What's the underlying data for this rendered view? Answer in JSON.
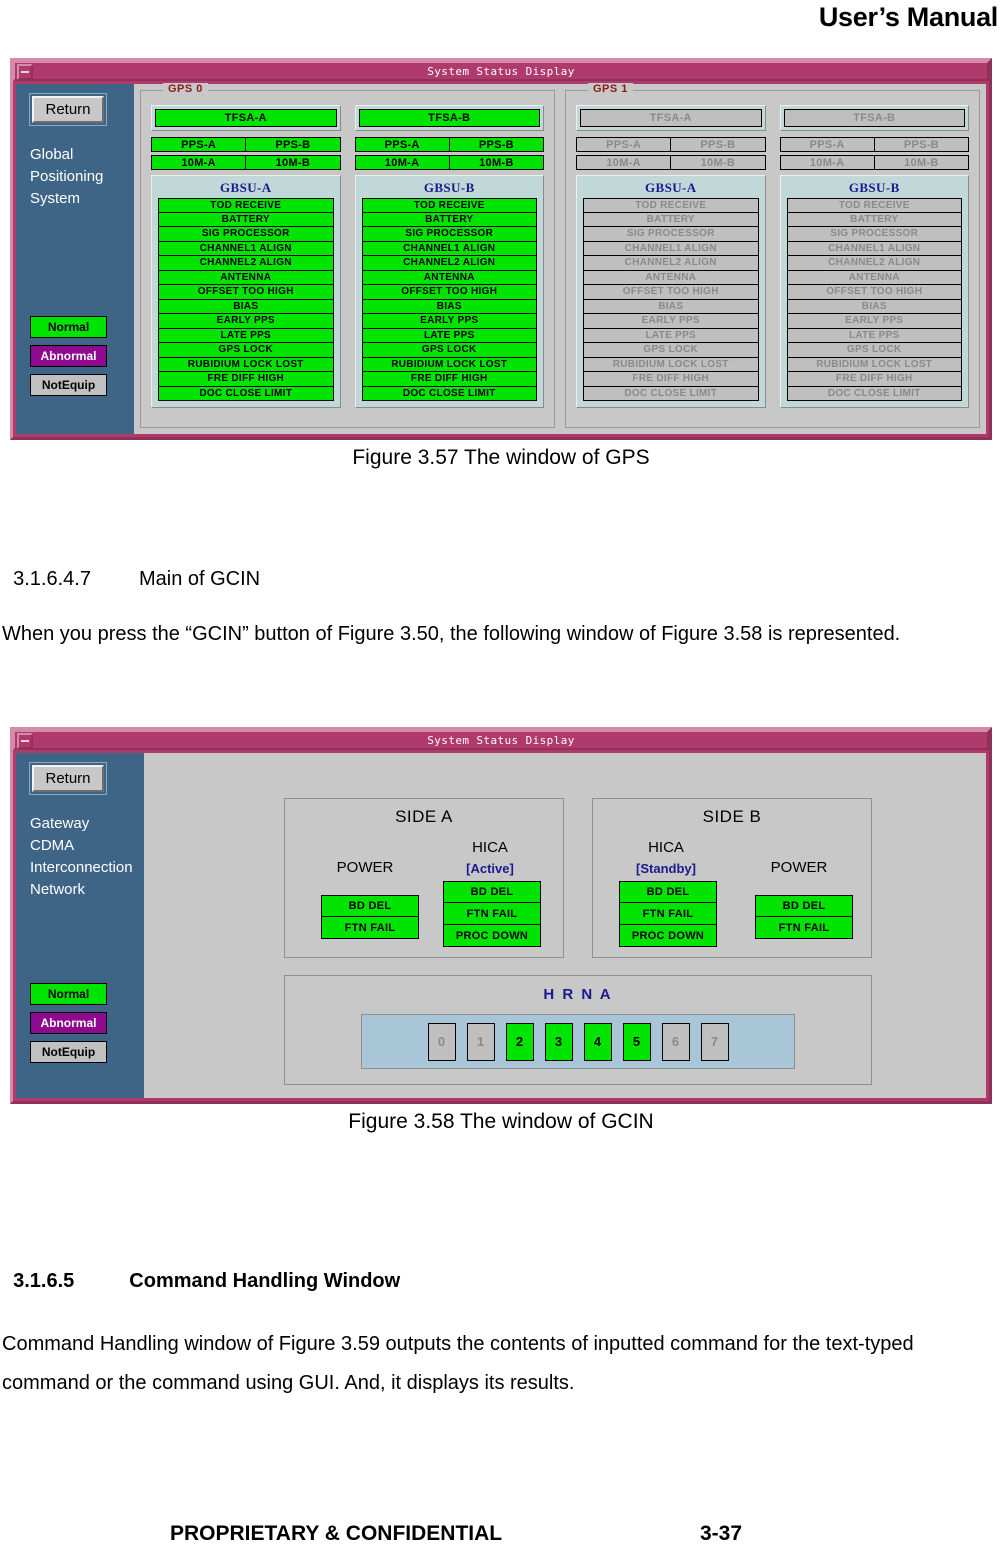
{
  "document": {
    "header_title": "User’s Manual",
    "footer_proprietary": "PROPRIETARY & CONFIDENTIAL",
    "footer_page": "3-37"
  },
  "figure_gps": {
    "caption": "Figure 3.57 The window of GPS",
    "window_title": "System Status Display",
    "sidebar": {
      "return_label": "Return",
      "system_name": "Global\nPositioning\nSystem",
      "legend": [
        {
          "label": "Normal",
          "state": "normal",
          "color": "#00e400"
        },
        {
          "label": "Abnormal",
          "state": "abnormal",
          "color": "#8e0a8e"
        },
        {
          "label": "NotEquip",
          "state": "notequip",
          "color": "#c0c0c0"
        }
      ]
    },
    "groups": [
      {
        "label": "GPS 0",
        "state": "on",
        "columns": [
          {
            "tfsa": "TFSA-A",
            "pps": [
              "PPS-A",
              "PPS-B"
            ],
            "tenm": [
              "10M-A",
              "10M-B"
            ],
            "gbsu_title": "GBSU-A",
            "gbsu_items": [
              "TOD RECEIVE",
              "BATTERY",
              "SIG PROCESSOR",
              "CHANNEL1 ALIGN",
              "CHANNEL2 ALIGN",
              "ANTENNA",
              "OFFSET TOO HIGH",
              "BIAS",
              "EARLY PPS",
              "LATE PPS",
              "GPS LOCK",
              "RUBIDIUM LOCK LOST",
              "FRE DIFF HIGH",
              "DOC CLOSE LIMIT"
            ]
          },
          {
            "tfsa": "TFSA-B",
            "pps": [
              "PPS-A",
              "PPS-B"
            ],
            "tenm": [
              "10M-A",
              "10M-B"
            ],
            "gbsu_title": "GBSU-B",
            "gbsu_items": [
              "TOD RECEIVE",
              "BATTERY",
              "SIG PROCESSOR",
              "CHANNEL1 ALIGN",
              "CHANNEL2 ALIGN",
              "ANTENNA",
              "OFFSET TOO HIGH",
              "BIAS",
              "EARLY PPS",
              "LATE PPS",
              "GPS LOCK",
              "RUBIDIUM LOCK LOST",
              "FRE DIFF HIGH",
              "DOC CLOSE LIMIT"
            ]
          }
        ]
      },
      {
        "label": "GPS 1",
        "state": "off",
        "columns": [
          {
            "tfsa": "TFSA-A",
            "pps": [
              "PPS-A",
              "PPS-B"
            ],
            "tenm": [
              "10M-A",
              "10M-B"
            ],
            "gbsu_title": "GBSU-A",
            "gbsu_items": [
              "TOD RECEIVE",
              "BATTERY",
              "SIG PROCESSOR",
              "CHANNEL1 ALIGN",
              "CHANNEL2 ALIGN",
              "ANTENNA",
              "OFFSET TOO HIGH",
              "BIAS",
              "EARLY PPS",
              "LATE PPS",
              "GPS LOCK",
              "RUBIDIUM LOCK LOST",
              "FRE DIFF HIGH",
              "DOC CLOSE LIMIT"
            ]
          },
          {
            "tfsa": "TFSA-B",
            "pps": [
              "PPS-A",
              "PPS-B"
            ],
            "tenm": [
              "10M-A",
              "10M-B"
            ],
            "gbsu_title": "GBSU-B",
            "gbsu_items": [
              "TOD RECEIVE",
              "BATTERY",
              "SIG PROCESSOR",
              "CHANNEL1 ALIGN",
              "CHANNEL2 ALIGN",
              "ANTENNA",
              "OFFSET TOO HIGH",
              "BIAS",
              "EARLY PPS",
              "LATE PPS",
              "GPS LOCK",
              "RUBIDIUM LOCK LOST",
              "FRE DIFF HIGH",
              "DOC CLOSE LIMIT"
            ]
          }
        ]
      }
    ]
  },
  "section_gcin": {
    "number": "3.1.6.4.7",
    "title": "Main of GCIN",
    "body": "When you press the “GCIN” button of Figure 3.50, the following window of Figure 3.58 is represented."
  },
  "figure_gcin": {
    "caption": "Figure 3.58 The window of GCIN",
    "window_title": "System Status Display",
    "sidebar": {
      "return_label": "Return",
      "system_name": "Gateway\nCDMA\nInterconnection\nNetwork",
      "legend": [
        {
          "label": "Normal",
          "state": "normal",
          "color": "#00e400"
        },
        {
          "label": "Abnormal",
          "state": "abnormal",
          "color": "#8e0a8e"
        },
        {
          "label": "NotEquip",
          "state": "notequip",
          "color": "#c0c0c0"
        }
      ]
    },
    "side_a": {
      "title": "SIDE A",
      "power": {
        "label": "POWER",
        "cells": [
          "BD DEL",
          "FTN FAIL"
        ],
        "states": [
          "on",
          "on"
        ]
      },
      "hica": {
        "label": "HICA",
        "status": "[Active]",
        "cells": [
          "BD DEL",
          "FTN FAIL",
          "PROC DOWN"
        ],
        "states": [
          "on",
          "on",
          "on"
        ]
      }
    },
    "side_b": {
      "title": "SIDE B",
      "hica": {
        "label": "HICA",
        "status": "[Standby]",
        "cells": [
          "BD DEL",
          "FTN FAIL",
          "PROC DOWN"
        ],
        "states": [
          "on",
          "on",
          "on"
        ]
      },
      "power": {
        "label": "POWER",
        "cells": [
          "BD DEL",
          "FTN FAIL"
        ],
        "states": [
          "on",
          "on"
        ]
      }
    },
    "hrna": {
      "title": "H R N A",
      "boxes": [
        {
          "label": "0",
          "state": "off"
        },
        {
          "label": "1",
          "state": "off"
        },
        {
          "label": "2",
          "state": "on"
        },
        {
          "label": "3",
          "state": "on"
        },
        {
          "label": "4",
          "state": "on"
        },
        {
          "label": "5",
          "state": "on"
        },
        {
          "label": "6",
          "state": "off"
        },
        {
          "label": "7",
          "state": "off"
        }
      ]
    }
  },
  "section_command": {
    "number": "3.1.6.5",
    "title": "Command Handling Window",
    "body": "Command Handling window of Figure 3.59 outputs the contents of inputted command for the text-typed command or the command using GUI. And, it displays its results."
  }
}
